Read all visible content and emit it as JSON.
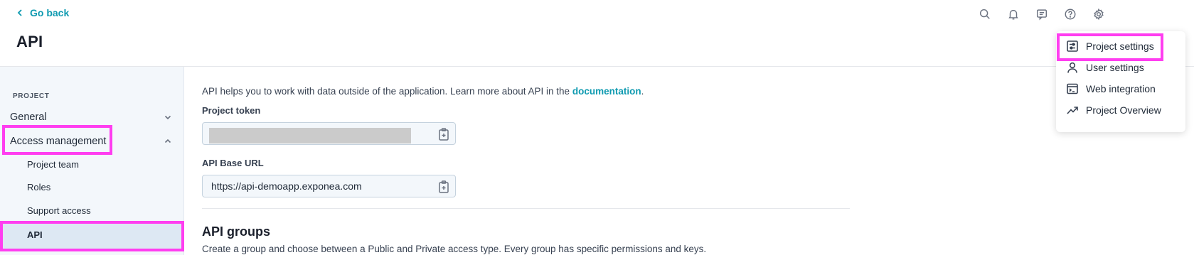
{
  "header": {
    "go_back": "Go back",
    "title": "API"
  },
  "top_icons": [
    "search-icon",
    "bell-icon",
    "chat-icon",
    "help-icon",
    "gear-icon"
  ],
  "sidebar": {
    "heading": "PROJECT",
    "items": [
      {
        "label": "General",
        "expanded": false
      },
      {
        "label": "Access management",
        "expanded": true
      }
    ],
    "sub_items": [
      {
        "label": "Project team"
      },
      {
        "label": "Roles"
      },
      {
        "label": "Support access"
      },
      {
        "label": "API",
        "active": true
      }
    ]
  },
  "main": {
    "intro_text": "API helps you to work with data outside of the application. Learn more about API in the ",
    "intro_link": "documentation",
    "intro_end": ".",
    "project_token_label": "Project token",
    "api_base_url_label": "API Base URL",
    "api_base_url_value": "https://api-demoapp.exponea.com",
    "groups_title": "API groups",
    "groups_desc": "Create a group and choose between a Public and Private access type. Every group has specific permissions and keys."
  },
  "dropdown": {
    "items": [
      {
        "label": "Project settings",
        "icon": "sliders-icon"
      },
      {
        "label": "User settings",
        "icon": "user-icon"
      },
      {
        "label": "Web integration",
        "icon": "terminal-icon"
      },
      {
        "label": "Project Overview",
        "icon": "trend-icon"
      }
    ]
  },
  "colors": {
    "accent": "#0e9ab0",
    "highlight": "#ff3ef0",
    "sidebar_bg": "#f3f7fb",
    "active_bg": "#dde8f3"
  }
}
